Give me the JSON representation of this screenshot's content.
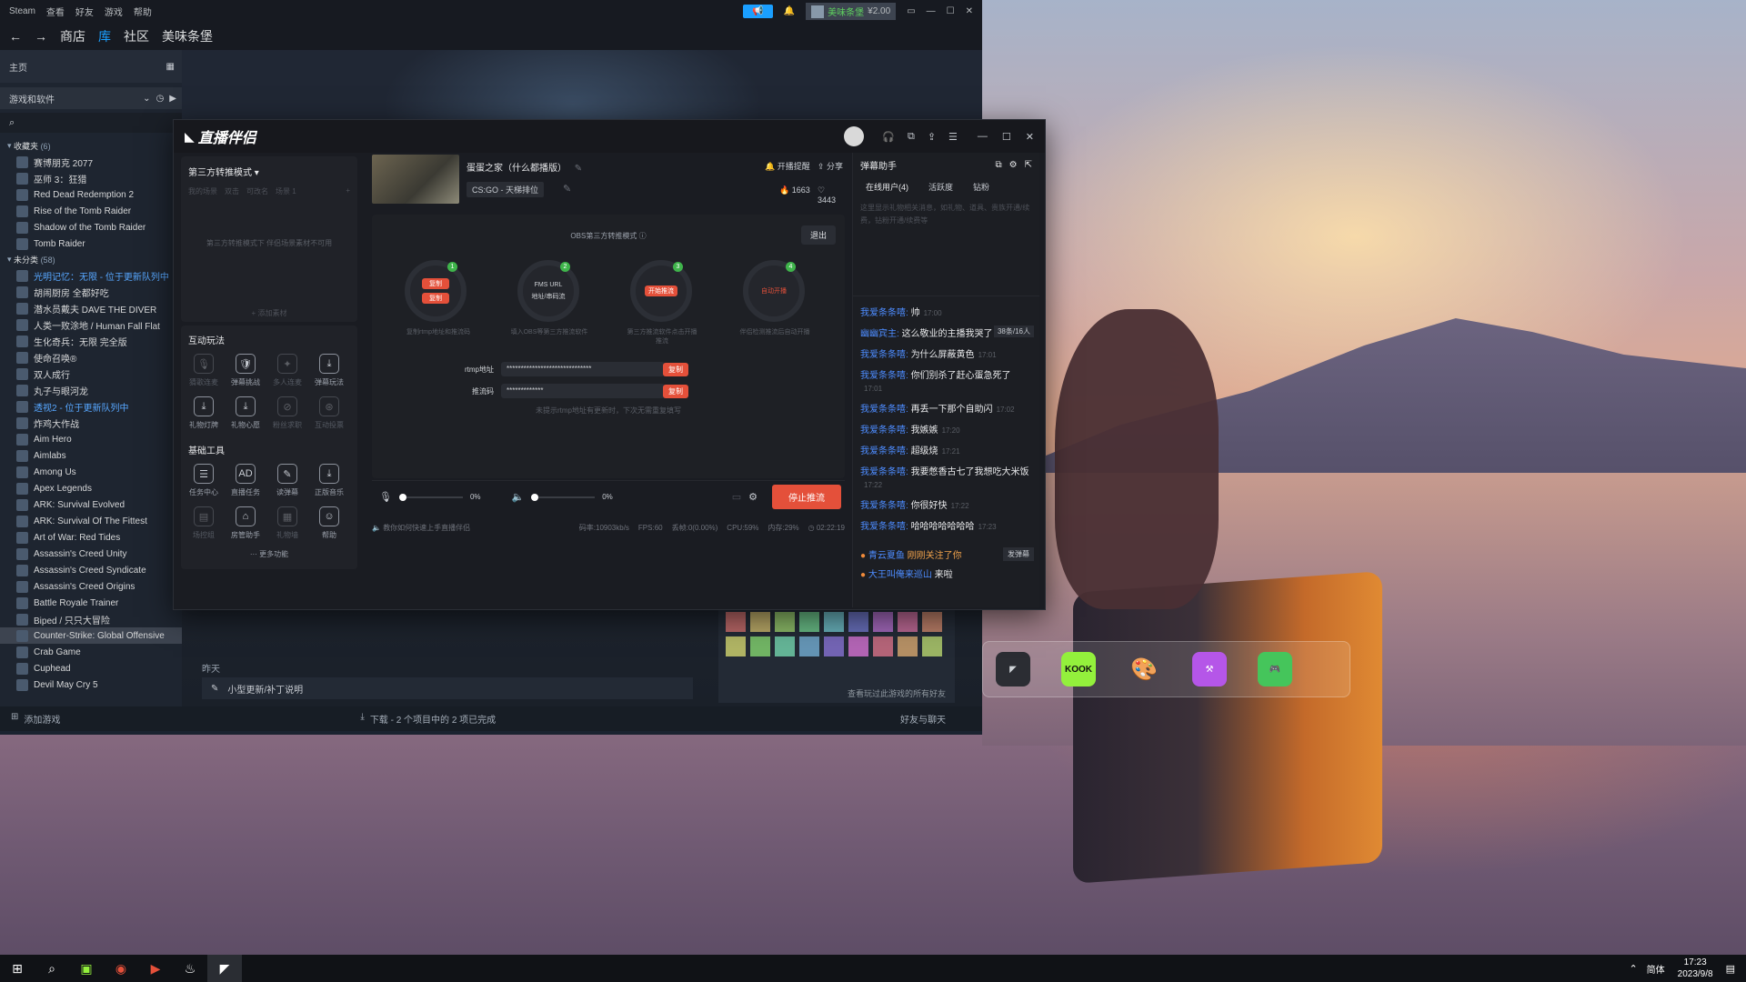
{
  "steam": {
    "menu": [
      "Steam",
      "查看",
      "好友",
      "游戏",
      "帮助"
    ],
    "user": "美味条堡",
    "balance": "¥2.00",
    "nav": [
      "商店",
      "库",
      "社区",
      "美味条堡"
    ],
    "home": "主页",
    "filter": "游戏和软件",
    "fav_header": "收藏夹",
    "fav_count": "(6)",
    "favorites": [
      "赛博朋克 2077",
      "巫师 3：狂猎",
      "Red Dead Redemption 2",
      "Rise of the Tomb Raider",
      "Shadow of the Tomb Raider",
      "Tomb Raider"
    ],
    "uncat_header": "未分类",
    "uncat_count": "(58)",
    "games": [
      {
        "name": "光明记忆：无限 - 位于更新队列中",
        "blue": true
      },
      {
        "name": "胡闹厨房 全都好吃"
      },
      {
        "name": "潜水员戴夫 DAVE THE DIVER"
      },
      {
        "name": "人类一败涂地 / Human Fall Flat"
      },
      {
        "name": "生化奇兵：无限 完全版"
      },
      {
        "name": "使命召唤®"
      },
      {
        "name": "双人成行"
      },
      {
        "name": "丸子与眼河龙"
      },
      {
        "name": "透视2 - 位于更新队列中",
        "blue": true
      },
      {
        "name": "炸鸡大作战"
      },
      {
        "name": "Aim Hero"
      },
      {
        "name": "Aimlabs"
      },
      {
        "name": "Among Us"
      },
      {
        "name": "Apex Legends"
      },
      {
        "name": "ARK: Survival Evolved"
      },
      {
        "name": "ARK: Survival Of The Fittest"
      },
      {
        "name": "Art of War: Red Tides"
      },
      {
        "name": "Assassin's Creed Unity"
      },
      {
        "name": "Assassin's Creed Syndicate"
      },
      {
        "name": "Assassin's Creed Origins"
      },
      {
        "name": "Battle Royale Trainer"
      },
      {
        "name": "Biped / 只只大冒险"
      },
      {
        "name": "Counter-Strike: Global Offensive",
        "sel": true
      },
      {
        "name": "Crab Game"
      },
      {
        "name": "Cuphead"
      },
      {
        "name": "Devil May Cry 5"
      }
    ],
    "add_game": "添加游戏",
    "downloads": "下载 - 2 个项目中的 2 项已完成",
    "friends_chat": "好友与聊天",
    "yesterday": "昨天",
    "update_note": "小型更新/补丁说明",
    "friends_link": "查看玩过此游戏的所有好友"
  },
  "live": {
    "logo": "直播伴侣",
    "mode": "第三方转推模式",
    "scene_tabs": [
      "我的场景",
      "双击",
      "可改名",
      "场景 1"
    ],
    "scene_empty": "第三方转推模式下 伴侣场景素材不可用",
    "add_material": "添加素材",
    "interactive_title": "互动玩法",
    "interactive": [
      {
        "label": "猜歌连麦",
        "icon": "🎙",
        "off": true
      },
      {
        "label": "弹幕挑战",
        "icon": "🛡"
      },
      {
        "label": "多人连麦",
        "icon": "✦",
        "off": true
      },
      {
        "label": "弹幕玩法",
        "icon": "⤓"
      },
      {
        "label": "礼物灯牌",
        "icon": "⤓"
      },
      {
        "label": "礼物心愿",
        "icon": "⤓"
      },
      {
        "label": "粉丝求职",
        "icon": "⊘",
        "off": true
      },
      {
        "label": "互动投票",
        "icon": "⊛",
        "off": true
      }
    ],
    "tools_title": "基础工具",
    "tools": [
      {
        "label": "任务中心",
        "icon": "☰"
      },
      {
        "label": "直播任务",
        "icon": "AD"
      },
      {
        "label": "读弹幕",
        "icon": "✎"
      },
      {
        "label": "正版音乐",
        "icon": "⤓"
      },
      {
        "label": "场控组",
        "icon": "▤",
        "off": true
      },
      {
        "label": "房管助手",
        "icon": "⌂"
      },
      {
        "label": "礼物墙",
        "icon": "▦",
        "off": true
      },
      {
        "label": "帮助",
        "icon": "☺"
      }
    ],
    "more": "更多功能",
    "stream_title": "蛋蛋之家（什么都播版）",
    "category": "CS:GO - 天梯排位",
    "alert": "开播提醒",
    "share": "分享",
    "likes": "1663",
    "hearts": "3443",
    "obs_mode": "OBS第三方转推模式",
    "exit": "退出",
    "steps": [
      {
        "num": "1",
        "desc": "复制rtmp地址和推流码",
        "btn1": "复制",
        "btn2": "复制"
      },
      {
        "num": "2",
        "desc": "填入OBS等第三方推流软件",
        "l1": "FMS URL",
        "l2": "地址/串码流"
      },
      {
        "num": "3",
        "desc": "第三方推流软件点击开播推流",
        "btn": "开始推流"
      },
      {
        "num": "4",
        "desc": "伴侣检测推流后自动开播",
        "txt": "自动开播"
      }
    ],
    "rtmp_label": "rtmp地址",
    "rtmp_value": "******************************",
    "key_label": "推流码",
    "key_value": "*************",
    "copy": "复制",
    "hint": "未提示rtmp地址有更新时，下次无需重复填写",
    "mic_pct": "0%",
    "vol_pct": "0%",
    "stop": "停止推流",
    "tip": "教你如何快速上手直播伴侣",
    "stats": [
      "码率:10903kb/s",
      "FPS:60",
      "丢帧:0(0.00%)",
      "CPU:59%",
      "内存:29%"
    ],
    "duration": "02:22:19",
    "assistant": "弹幕助手",
    "tabs": [
      "在线用户(4)",
      "活跃度",
      "钻粉"
    ],
    "notice": "这里显示礼物相关消息，如礼物、道具、贵族开通/续费，钻粉开通/续费等",
    "viewers": "38条/16人",
    "chat": [
      {
        "u": "我爱条条嘻:",
        "m": "帅",
        "t": "17:00"
      },
      {
        "u": "幽幽宾主:",
        "m": "这么敬业的主播我哭了",
        "t": "17:00"
      },
      {
        "u": "我爱条条嘻:",
        "m": "为什么屏蔽黄色",
        "t": "17:01"
      },
      {
        "u": "我爱条条嘻:",
        "m": "你们别杀了赶心蛋急死了",
        "t": "17:01"
      },
      {
        "u": "我爱条条嘻:",
        "m": "再丢一下那个自助闪",
        "t": "17:02"
      },
      {
        "u": "我爱条条嘻:",
        "m": "我嫉嫉",
        "t": "17:20"
      },
      {
        "u": "我爱条条嘻:",
        "m": "超级烧",
        "t": "17:21"
      },
      {
        "u": "我爱条条嘻:",
        "m": "我要憋香古七了我想吃大米饭",
        "t": "17:22"
      },
      {
        "u": "我爱条条嘻:",
        "m": "你很好快",
        "t": "17:22"
      },
      {
        "u": "我爱条条嘻:",
        "m": "哈哈哈哈哈哈哈",
        "t": "17:23"
      }
    ],
    "follow_user": "青云夏鱼",
    "follow_msg": "刚刚关注了你",
    "send_danmaku": "发弹幕",
    "enter_user": "大王叫俺来巡山",
    "enter_msg": "来啦"
  },
  "dock": [
    "KOOK"
  ],
  "taskbar": {
    "lang": "简体",
    "time": "17:23",
    "date": "2023/9/8"
  }
}
